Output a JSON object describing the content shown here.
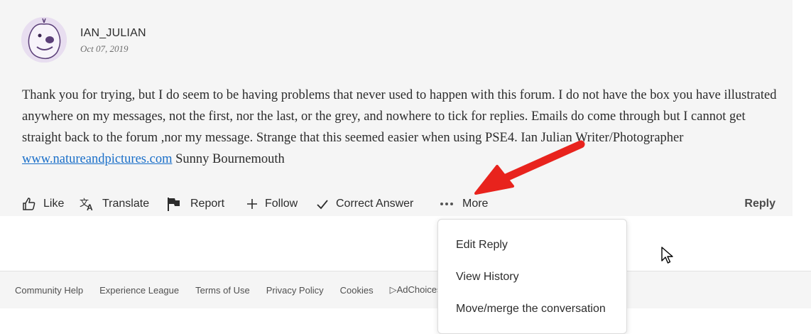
{
  "post": {
    "author": "IAN_JULIAN",
    "date": "Oct 07, 2019",
    "body": "Thank you for trying, but I do seem to be having problems that never used to happen with this forum. I do not have the box you have illustrated anywhere on my messages, not the first, nor the last, or the grey, and nowhere to tick for replies. Emails do come through but I cannot get straight back to the forum ,nor my message. Strange that this seemed easier when using PSE4. Ian Julian Writer/Photographer ",
    "link": "www.natureandpictures.com",
    "body_after_link": " Sunny Bournemouth"
  },
  "actions": {
    "like": "Like",
    "translate": "Translate",
    "report": "Report",
    "follow": "Follow",
    "correct_answer": "Correct Answer",
    "more": "More",
    "reply": "Reply"
  },
  "menu": {
    "items": [
      "Edit Reply",
      "View History",
      "Move/merge the conversation"
    ]
  },
  "footer": {
    "links": [
      "Community Help",
      "Experience League",
      "Terms of Use",
      "Privacy Policy",
      "Cookies",
      "▷AdChoices"
    ]
  },
  "colors": {
    "link": "#1a6fc9",
    "annotation_arrow": "#e8231d",
    "post_bg": "#f5f5f5"
  }
}
